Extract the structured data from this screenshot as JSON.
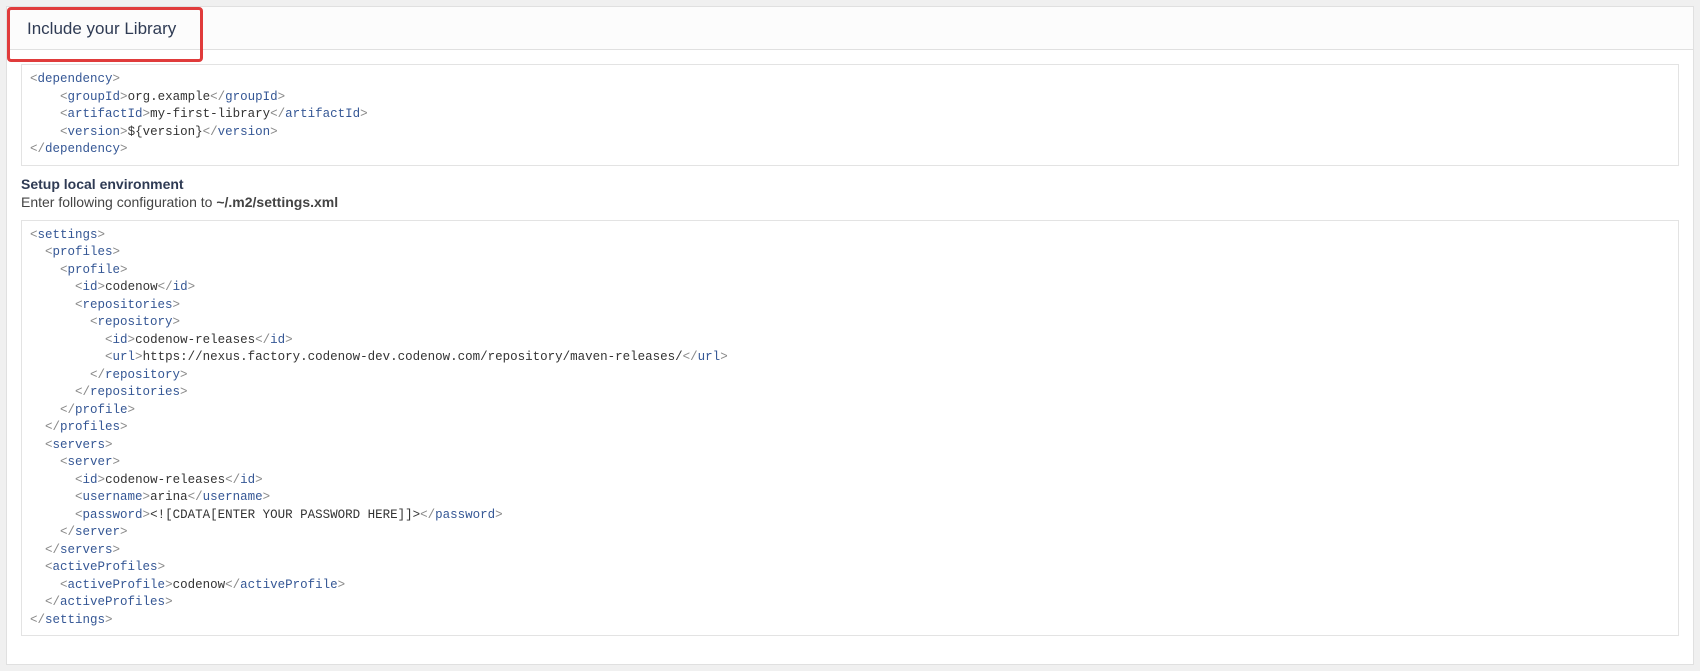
{
  "header": {
    "title": "Include your Library"
  },
  "dependency": {
    "groupId": "org.example",
    "artifactId": "my-first-library",
    "version": "${version}"
  },
  "setup": {
    "heading": "Setup local environment",
    "instruction_prefix": "Enter following configuration to ",
    "instruction_path": "~/.m2/settings.xml"
  },
  "settings": {
    "profile_id": "codenow",
    "repository_id": "codenow-releases",
    "repository_url": "https://nexus.factory.codenow-dev.codenow.com/repository/maven-releases/",
    "server_id": "codenow-releases",
    "server_username": "arina",
    "server_password": "<![CDATA[ENTER YOUR PASSWORD HERE]]>",
    "active_profile": "codenow"
  }
}
